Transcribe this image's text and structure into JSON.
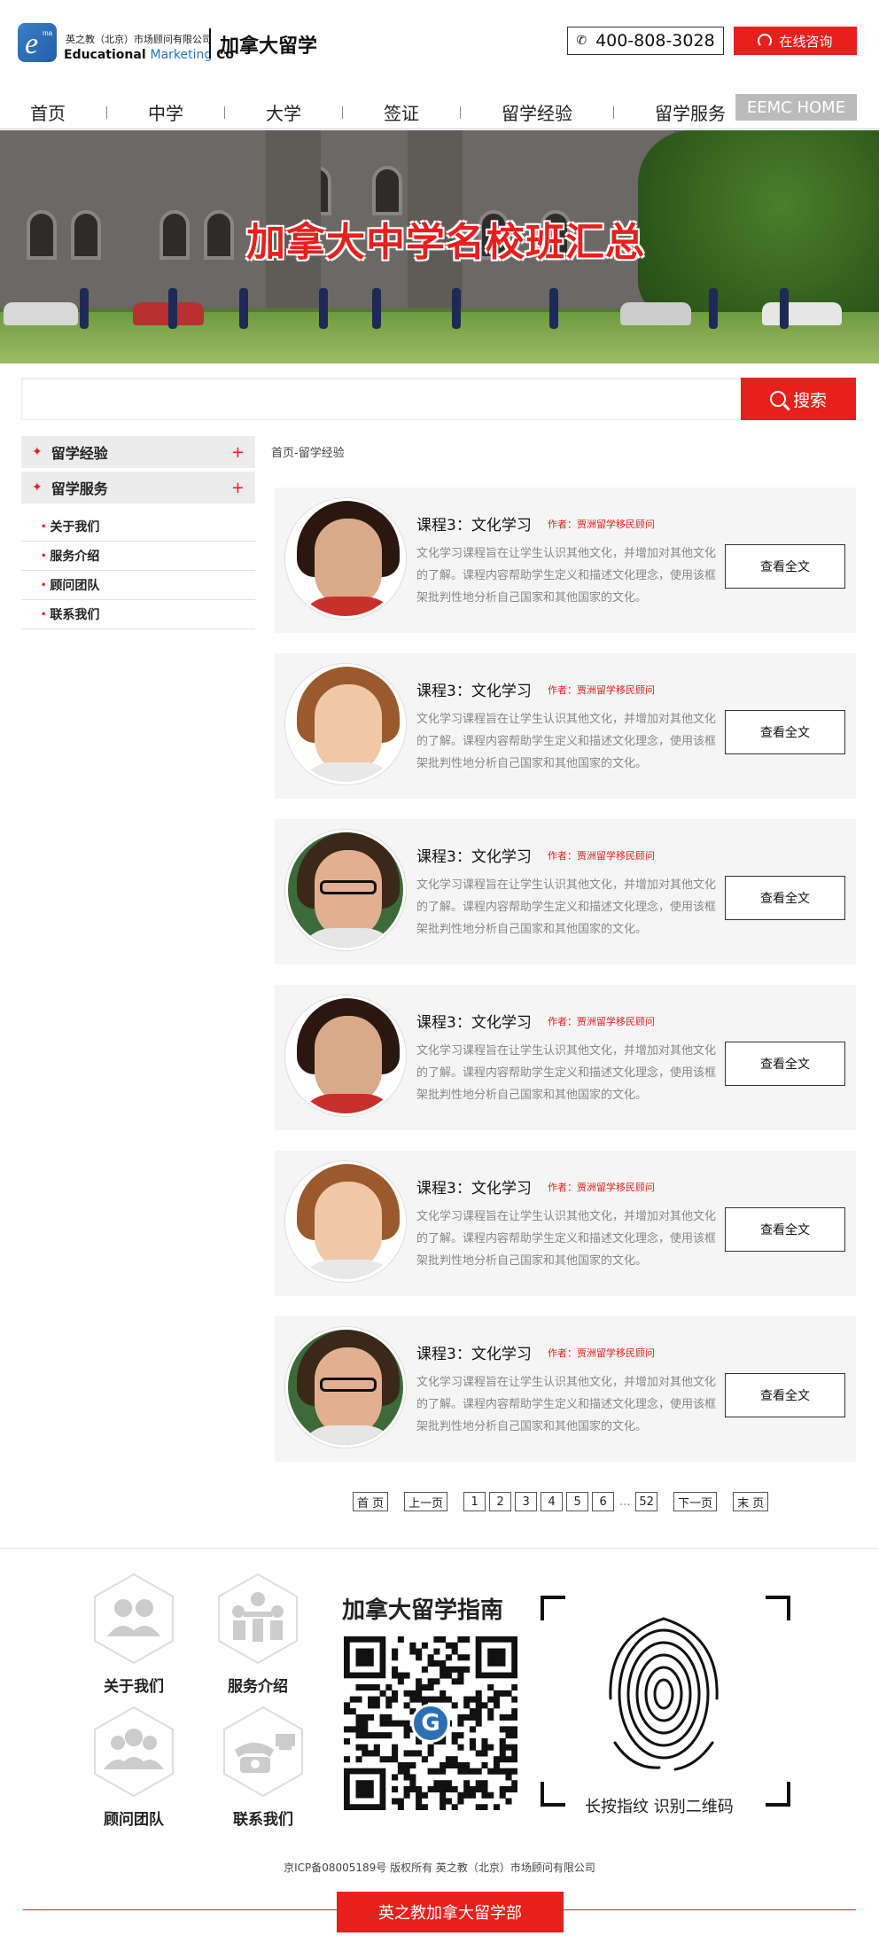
{
  "header": {
    "logo_cn": "英之教（北京）市场顾问有限公司",
    "logo_en_main": "Educational ",
    "logo_en_blue": "Marketing",
    "logo_en_tail": " Co",
    "site_title": "加拿大留学",
    "phone": "400-808-3028",
    "consult_label": "在线咨询"
  },
  "nav": {
    "items": [
      "首页",
      "中学",
      "大学",
      "签证",
      "留学经验",
      "留学服务"
    ],
    "active_index": 0,
    "home_button": "EEMC HOME"
  },
  "banner": {
    "title": "加拿大中学名校班汇总"
  },
  "search": {
    "placeholder": "",
    "button_label": "搜索"
  },
  "sidebar": {
    "headers": [
      {
        "label": "留学经验",
        "toggle": "+"
      },
      {
        "label": "留学服务",
        "toggle": "+"
      }
    ],
    "subitems": [
      "关于我们",
      "服务介绍",
      "顾问团队",
      "联系我们"
    ]
  },
  "breadcrumb": "首页-留学经验",
  "articles": [
    {
      "title": "课程3：文化学习",
      "author": "作者：贾洲留学移民顾问",
      "desc": "文化学习课程旨在让学生认识其他文化，并增加对其他文化的了解。课程内容帮助学生定义和描述文化理念，使用该框架批判性地分析自己国家和其他国家的文化。",
      "button": "查看全文",
      "avatar": "woman-dark-hair"
    },
    {
      "title": "课程3：文化学习",
      "author": "作者：贾洲留学移民顾问",
      "desc": "文化学习课程旨在让学生认识其他文化，并增加对其他文化的了解。课程内容帮助学生定义和描述文化理念，使用该框架批判性地分析自己国家和其他国家的文化。",
      "button": "查看全文",
      "avatar": "woman-auburn-hair"
    },
    {
      "title": "课程3：文化学习",
      "author": "作者：贾洲留学移民顾问",
      "desc": "文化学习课程旨在让学生认识其他文化，并增加对其他文化的了解。课程内容帮助学生定义和描述文化理念，使用该框架批判性地分析自己国家和其他国家的文化。",
      "button": "查看全文",
      "avatar": "man-glasses"
    },
    {
      "title": "课程3：文化学习",
      "author": "作者：贾洲留学移民顾问",
      "desc": "文化学习课程旨在让学生认识其他文化，并增加对其他文化的了解。课程内容帮助学生定义和描述文化理念，使用该框架批判性地分析自己国家和其他国家的文化。",
      "button": "查看全文",
      "avatar": "woman-dark-hair"
    },
    {
      "title": "课程3：文化学习",
      "author": "作者：贾洲留学移民顾问",
      "desc": "文化学习课程旨在让学生认识其他文化，并增加对其他文化的了解。课程内容帮助学生定义和描述文化理念，使用该框架批判性地分析自己国家和其他国家的文化。",
      "button": "查看全文",
      "avatar": "woman-auburn-hair"
    },
    {
      "title": "课程3：文化学习",
      "author": "作者：贾洲留学移民顾问",
      "desc": "文化学习课程旨在让学生认识其他文化，并增加对其他文化的了解。课程内容帮助学生定义和描述文化理念，使用该框架批判性地分析自己国家和其他国家的文化。",
      "button": "查看全文",
      "avatar": "man-glasses"
    }
  ],
  "pagination": {
    "first": "首 页",
    "prev": "上一页",
    "pages": [
      "1",
      "2",
      "3",
      "4",
      "5",
      "6"
    ],
    "ellipsis": "...",
    "last_page": "52",
    "next": "下一页",
    "last": "末 页"
  },
  "footer": {
    "nav": [
      {
        "label": "关于我们",
        "icon": "people-pair-icon"
      },
      {
        "label": "服务介绍",
        "icon": "meeting-icon"
      },
      {
        "label": "顾问团队",
        "icon": "team-icon"
      },
      {
        "label": "联系我们",
        "icon": "telephone-icon"
      }
    ],
    "guide_title": "加拿大留学指南",
    "qr_badge": "G",
    "fingerprint_caption": "长按指纹 识别二维码",
    "icp": "京ICP备08005189号 版权所有 英之教（北京）市场顾问有限公司",
    "bottom_tab": "英之教加拿大留学部"
  },
  "colors": {
    "accent": "#e5201d",
    "card_bg": "#f5f5f5",
    "nav_home_bg": "#bbbbbb"
  }
}
